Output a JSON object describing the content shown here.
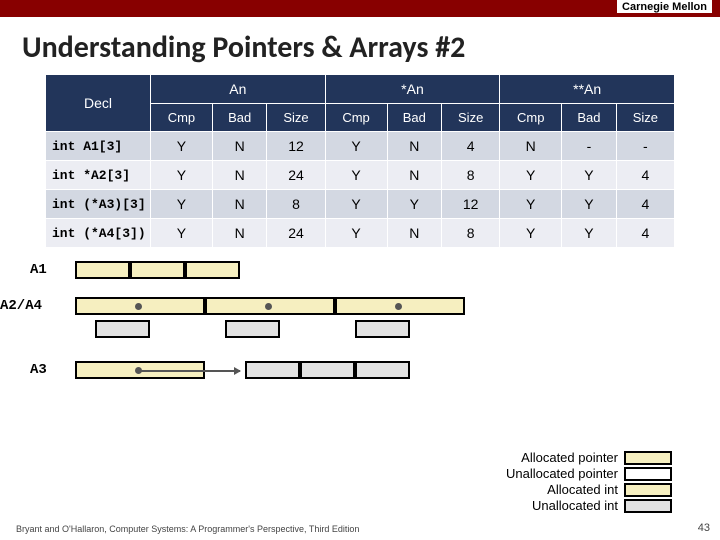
{
  "brand": "Carnegie Mellon",
  "title": "Understanding Pointers & Arrays #2",
  "headers": {
    "decl": "Decl",
    "g1": "An",
    "g2": "*An",
    "g3": "**An",
    "sub": [
      "Cmp",
      "Bad",
      "Size",
      "Cmp",
      "Bad",
      "Size",
      "Cmp",
      "Bad",
      "Size"
    ]
  },
  "rows": [
    {
      "decl": "int A1[3]",
      "c": [
        "Y",
        "N",
        "12",
        "Y",
        "N",
        "4",
        "N",
        "-",
        "-"
      ]
    },
    {
      "decl": "int *A2[3]",
      "c": [
        "Y",
        "N",
        "24",
        "Y",
        "N",
        "8",
        "Y",
        "Y",
        "4"
      ]
    },
    {
      "decl": "int (*A3)[3]",
      "c": [
        "Y",
        "N",
        "8",
        "Y",
        "Y",
        "12",
        "Y",
        "Y",
        "4"
      ]
    },
    {
      "decl": "int (*A4[3])",
      "c": [
        "Y",
        "N",
        "24",
        "Y",
        "N",
        "8",
        "Y",
        "Y",
        "4"
      ]
    }
  ],
  "diag_labels": {
    "a1": "A1",
    "a24": "A2/A4",
    "a3": "A3"
  },
  "legend": {
    "ap": "Allocated pointer",
    "up": "Unallocated pointer",
    "ai": "Allocated int",
    "ui": "Unallocated int"
  },
  "footer": "Bryant and O'Hallaron, Computer Systems: A Programmer's Perspective, Third Edition",
  "pagenum": "43",
  "chart_data": {
    "type": "table",
    "title": "Understanding Pointers & Arrays #2",
    "columns": [
      "Decl",
      "An Cmp",
      "An Bad",
      "An Size",
      "*An Cmp",
      "*An Bad",
      "*An Size",
      "**An Cmp",
      "**An Bad",
      "**An Size"
    ],
    "rows": [
      [
        "int A1[3]",
        "Y",
        "N",
        12,
        "Y",
        "N",
        4,
        "N",
        "-",
        "-"
      ],
      [
        "int *A2[3]",
        "Y",
        "N",
        24,
        "Y",
        "N",
        8,
        "Y",
        "Y",
        4
      ],
      [
        "int (*A3)[3]",
        "Y",
        "N",
        8,
        "Y",
        "Y",
        12,
        "Y",
        "Y",
        4
      ],
      [
        "int (*A4[3])",
        "Y",
        "N",
        24,
        "Y",
        "N",
        8,
        "Y",
        "Y",
        4
      ]
    ]
  }
}
